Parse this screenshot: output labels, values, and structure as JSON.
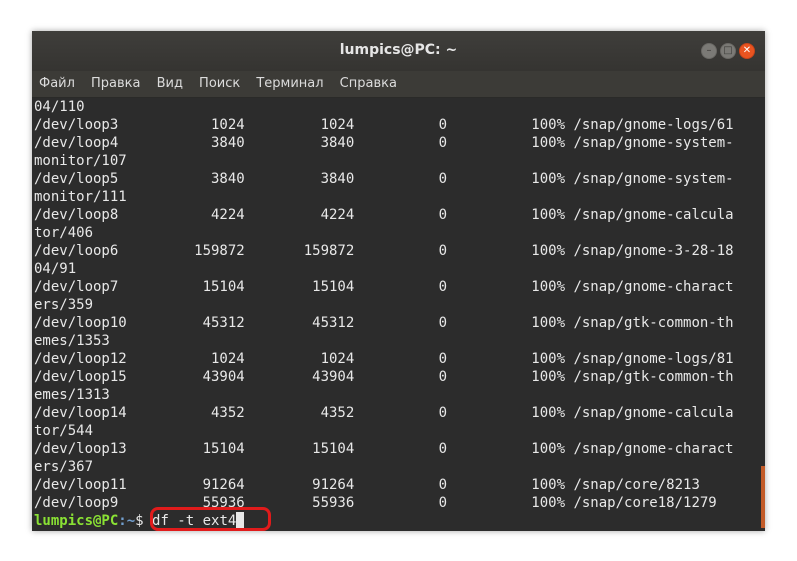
{
  "window": {
    "title": "lumpics@PC: ~"
  },
  "menu": [
    {
      "label": "Файл"
    },
    {
      "label": "Правка"
    },
    {
      "label": "Вид"
    },
    {
      "label": "Поиск"
    },
    {
      "label": "Терминал"
    },
    {
      "label": "Справка"
    }
  ],
  "terminal": {
    "lines": [
      "04/110",
      "/dev/loop3           1024         1024          0          100% /snap/gnome-logs/61",
      "/dev/loop4           3840         3840          0          100% /snap/gnome-system-",
      "monitor/107",
      "/dev/loop5           3840         3840          0          100% /snap/gnome-system-",
      "monitor/111",
      "/dev/loop8           4224         4224          0          100% /snap/gnome-calcula",
      "tor/406",
      "/dev/loop6         159872       159872          0          100% /snap/gnome-3-28-18",
      "04/91",
      "/dev/loop7          15104        15104          0          100% /snap/gnome-charact",
      "ers/359",
      "/dev/loop10         45312        45312          0          100% /snap/gtk-common-th",
      "emes/1353",
      "/dev/loop12          1024         1024          0          100% /snap/gnome-logs/81",
      "/dev/loop15         43904        43904          0          100% /snap/gtk-common-th",
      "emes/1313",
      "/dev/loop14          4352         4352          0          100% /snap/gnome-calcula",
      "tor/544",
      "/dev/loop13         15104        15104          0          100% /snap/gnome-charact",
      "ers/367",
      "/dev/loop11         91264        91264          0          100% /snap/core/8213",
      "/dev/loop9          55936        55936          0          100% /snap/core18/1279"
    ],
    "prompt": {
      "user_host": "lumpics@PC",
      "path": ":~",
      "symbol": "$ ",
      "command": "df -t ext4"
    }
  },
  "colors": {
    "highlight": "#e01b1b",
    "prompt_user": "#8ae234",
    "prompt_path": "#729fcf",
    "close_button": "#e95420",
    "scrollbar": "#c35b28"
  }
}
